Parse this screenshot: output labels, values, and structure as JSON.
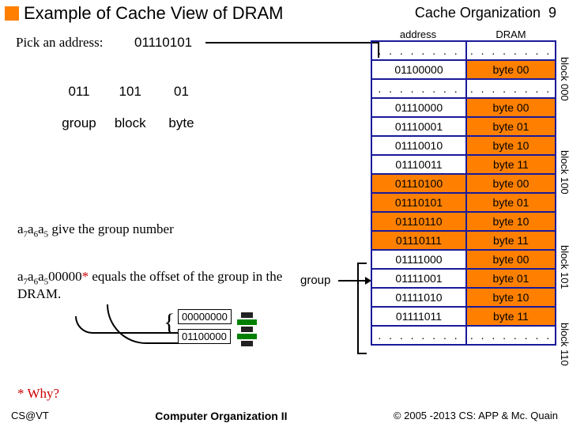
{
  "title": "Example of Cache View of DRAM",
  "header_right": "Cache Organization",
  "page_number": "9",
  "pick_label": "Pick an address:",
  "chosen_address": "01110101",
  "breakdown": {
    "group_bits": "011",
    "block_bits": "101",
    "byte_bits": "01",
    "group_label": "group",
    "block_label": "block",
    "byte_label": "byte"
  },
  "explain1": {
    "pre": "a",
    "s1": "7",
    "s2": "6",
    "s3": "5",
    "post": " give the group number"
  },
  "explain2": {
    "pre": "a",
    "s1": "7",
    "s2": "6",
    "s3": "5",
    "offset": "00000",
    "star": "*",
    "post": " equals the offset of the group in the DRAM."
  },
  "offset_zero": "00000000",
  "offset_one": "01100000",
  "why_label": "* Why?",
  "group_side": "group",
  "table_headers": {
    "c1": "address",
    "c2": "DRAM"
  },
  "rows": [
    {
      "addr": ". . . . . . . .",
      "byte": ". . . . . . . .",
      "dots": true
    },
    {
      "addr": "01100000",
      "byte": "byte 00"
    },
    {
      "addr": ". . . . . . . .",
      "byte": ". . . . . . . .",
      "dots": true
    },
    {
      "addr": "01110000",
      "byte": "byte 00"
    },
    {
      "addr": "01110001",
      "byte": "byte 01"
    },
    {
      "addr": "01110010",
      "byte": "byte 10"
    },
    {
      "addr": "01110011",
      "byte": "byte 11"
    },
    {
      "addr": "01110100",
      "byte": "byte 00",
      "hl": true
    },
    {
      "addr": "01110101",
      "byte": "byte 01",
      "hl": true
    },
    {
      "addr": "01110110",
      "byte": "byte 10",
      "hl": true
    },
    {
      "addr": "01110111",
      "byte": "byte 11",
      "hl": true
    },
    {
      "addr": "01111000",
      "byte": "byte 00"
    },
    {
      "addr": "01111001",
      "byte": "byte 01"
    },
    {
      "addr": "01111010",
      "byte": "byte 10"
    },
    {
      "addr": "01111011",
      "byte": "byte 11"
    },
    {
      "addr": ". . . . . . . .",
      "byte": ". . . . . . . .",
      "dots": true
    }
  ],
  "block_labels": [
    "block 000",
    "block 100",
    "block 101",
    "block 110"
  ],
  "footer": {
    "left": "CS@VT",
    "mid": "Computer Organization II",
    "right": "© 2005 -2013 CS: APP & Mc. Quain"
  }
}
